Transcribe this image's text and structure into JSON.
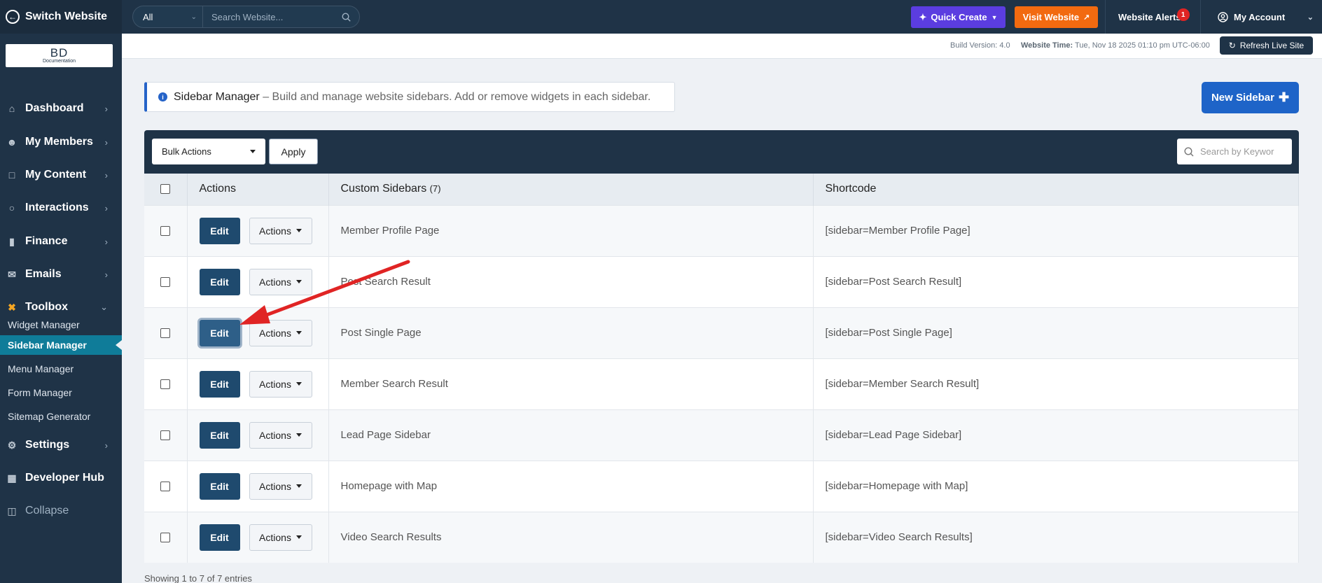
{
  "topbar": {
    "switch_label": "Switch Website",
    "search_scope": "All",
    "search_placeholder": "Search Website...",
    "quick_create": "Quick Create",
    "visit_website": "Visit Website",
    "alerts_label": "Website Alerts",
    "alerts_count": "1",
    "account_label": "My Account"
  },
  "subbar": {
    "build_version": "Build Version: 4.0",
    "website_time_label": "Website Time:",
    "website_time_value": "Tue, Nov 18 2025 01:10 pm UTC-06:00",
    "refresh_label": "Refresh Live Site"
  },
  "sidebar": {
    "logo_main": "BD",
    "logo_sub": "Documentation",
    "nav": [
      {
        "label": "Dashboard",
        "icon": "home-icon"
      },
      {
        "label": "My Members",
        "icon": "members-icon"
      },
      {
        "label": "My Content",
        "icon": "folder-icon"
      },
      {
        "label": "Interactions",
        "icon": "chat-icon"
      },
      {
        "label": "Finance",
        "icon": "chart-icon"
      },
      {
        "label": "Emails",
        "icon": "mail-icon"
      },
      {
        "label": "Toolbox",
        "icon": "tools-icon"
      }
    ],
    "toolbox_items": [
      "Widget Manager",
      "Sidebar Manager",
      "Menu Manager",
      "Form Manager",
      "Sitemap Generator"
    ],
    "active_item": "Sidebar Manager",
    "settings_label": "Settings",
    "developer_label": "Developer Hub",
    "collapse_label": "Collapse"
  },
  "banner": {
    "title": "Sidebar Manager",
    "description": " – Build and manage website sidebars. Add or remove widgets in each sidebar."
  },
  "new_sidebar_button": "New Sidebar",
  "toolbar": {
    "bulk_actions": "Bulk Actions",
    "apply": "Apply",
    "keyword_placeholder": "Search by Keywor"
  },
  "table": {
    "headers": {
      "actions": "Actions",
      "custom_sidebars": "Custom Sidebars",
      "count": "(7)",
      "shortcode": "Shortcode"
    },
    "edit_label": "Edit",
    "actions_label": "Actions",
    "rows": [
      {
        "name": "Member Profile Page",
        "shortcode": "[sidebar=Member Profile Page]"
      },
      {
        "name": "Post Search Result",
        "shortcode": "[sidebar=Post Search Result]"
      },
      {
        "name": "Post Single Page",
        "shortcode": "[sidebar=Post Single Page]"
      },
      {
        "name": "Member Search Result",
        "shortcode": "[sidebar=Member Search Result]"
      },
      {
        "name": "Lead Page Sidebar",
        "shortcode": "[sidebar=Lead Page Sidebar]"
      },
      {
        "name": "Homepage with Map",
        "shortcode": "[sidebar=Homepage with Map]"
      },
      {
        "name": "Video Search Results",
        "shortcode": "[sidebar=Video Search Results]"
      }
    ],
    "highlighted_row": 2
  },
  "footer": "Showing 1 to 7 of 7 entries",
  "colors": {
    "navy": "#1f3347",
    "accent_blue": "#1e64c8",
    "quick_create": "#5b3de0",
    "visit_website": "#f26a10",
    "active_teal": "#0f7c99",
    "annotation_arrow": "#e02424"
  }
}
